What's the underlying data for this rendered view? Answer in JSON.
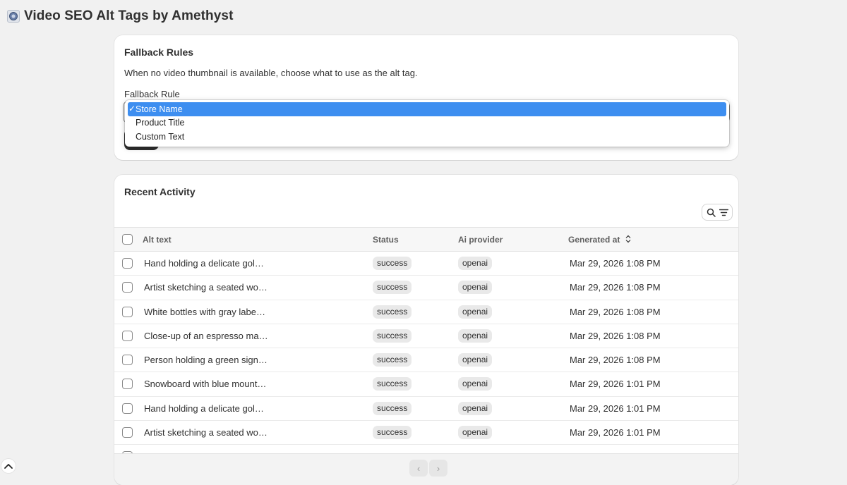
{
  "app": {
    "title": "Video SEO Alt Tags by Amethyst",
    "icon": "app-logo-icon"
  },
  "fallback": {
    "title": "Fallback Rules",
    "description": "When no video thumbnail is available, choose what to use as the alt tag.",
    "rule_label": "Fallback Rule",
    "options": [
      "Store Name",
      "Product Title",
      "Custom Text"
    ],
    "selected_option": "Store Name",
    "check_mark": "✓"
  },
  "activity": {
    "title": "Recent Activity",
    "columns": {
      "alt_text": "Alt text",
      "status": "Status",
      "ai_provider": "Ai provider",
      "generated_at": "Generated at"
    },
    "rows": [
      {
        "alt": "Hand holding a delicate gol…",
        "status": "success",
        "provider": "openai",
        "date": "Mar 29, 2026 1:08 PM"
      },
      {
        "alt": "Artist sketching a seated wo…",
        "status": "success",
        "provider": "openai",
        "date": "Mar 29, 2026 1:08 PM"
      },
      {
        "alt": "White bottles with gray labe…",
        "status": "success",
        "provider": "openai",
        "date": "Mar 29, 2026 1:08 PM"
      },
      {
        "alt": "Close-up of an espresso ma…",
        "status": "success",
        "provider": "openai",
        "date": "Mar 29, 2026 1:08 PM"
      },
      {
        "alt": "Person holding a green sign…",
        "status": "success",
        "provider": "openai",
        "date": "Mar 29, 2026 1:08 PM"
      },
      {
        "alt": "Snowboard with blue mount…",
        "status": "success",
        "provider": "openai",
        "date": "Mar 29, 2026 1:01 PM"
      },
      {
        "alt": "Hand holding a delicate gol…",
        "status": "success",
        "provider": "openai",
        "date": "Mar 29, 2026 1:01 PM"
      },
      {
        "alt": "Artist sketching a seated wo…",
        "status": "success",
        "provider": "openai",
        "date": "Mar 29, 2026 1:01 PM"
      }
    ],
    "pagination": {
      "prev": "‹",
      "next": "›"
    }
  },
  "colors": {
    "primary_button": "#303030",
    "selected_option_bg": "#3d8ef0",
    "page_bg": "#f1f1f1"
  }
}
